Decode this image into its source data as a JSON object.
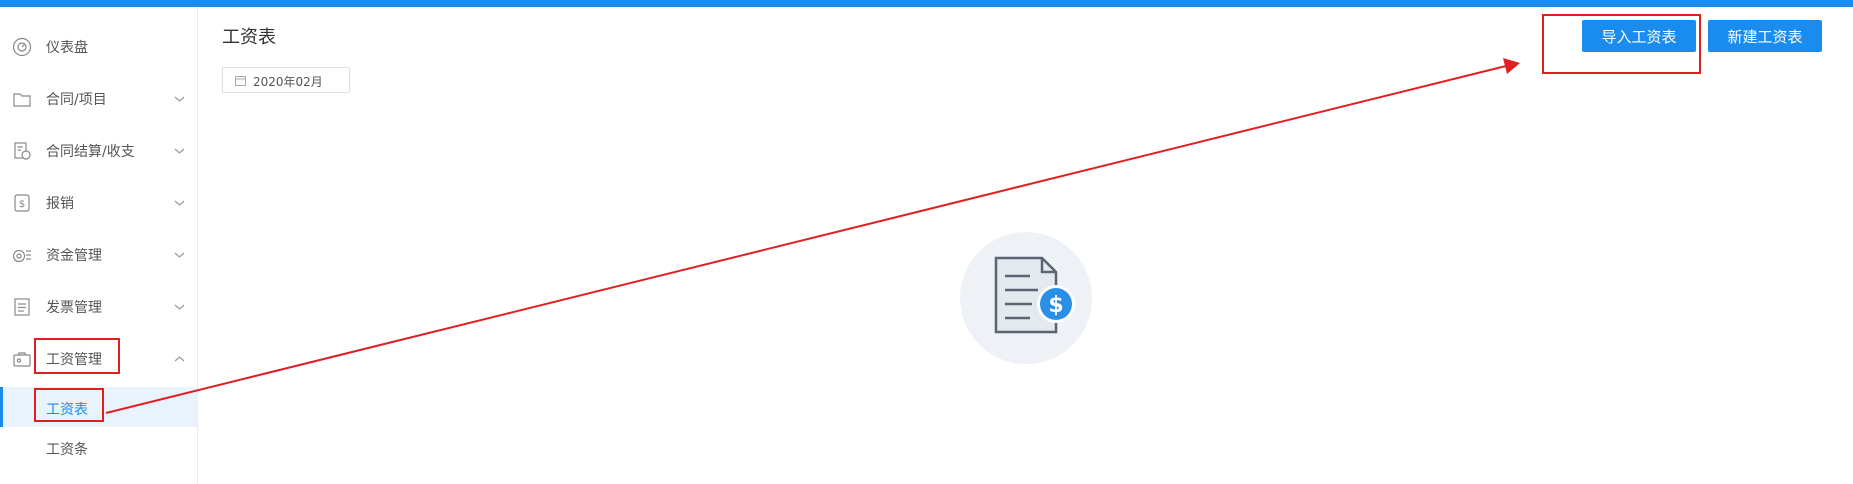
{
  "sidebar": {
    "items": [
      {
        "label": "仪表盘",
        "icon": "dashboard-icon",
        "expandable": false
      },
      {
        "label": "合同/项目",
        "icon": "folder-icon",
        "expandable": true
      },
      {
        "label": "合同结算/收支",
        "icon": "settlement-document-icon",
        "expandable": true
      },
      {
        "label": "报销",
        "icon": "reimbursement-icon",
        "expandable": true
      },
      {
        "label": "资金管理",
        "icon": "fund-icon",
        "expandable": true
      },
      {
        "label": "发票管理",
        "icon": "invoice-icon",
        "expandable": true
      },
      {
        "label": "工资管理",
        "icon": "briefcase-icon",
        "expandable": true,
        "expanded": true
      }
    ],
    "sub_items": [
      {
        "label": "工资表",
        "active": true
      },
      {
        "label": "工资条",
        "active": false
      }
    ]
  },
  "main": {
    "title": "工资表",
    "date_value": "2020年02月",
    "empty_icon": "payroll-document-dollar-icon"
  },
  "toolbar": {
    "import_label": "导入工资表",
    "new_label": "新建工资表"
  },
  "colors": {
    "accent": "#1a8cf0",
    "annotation": "#e02020"
  }
}
